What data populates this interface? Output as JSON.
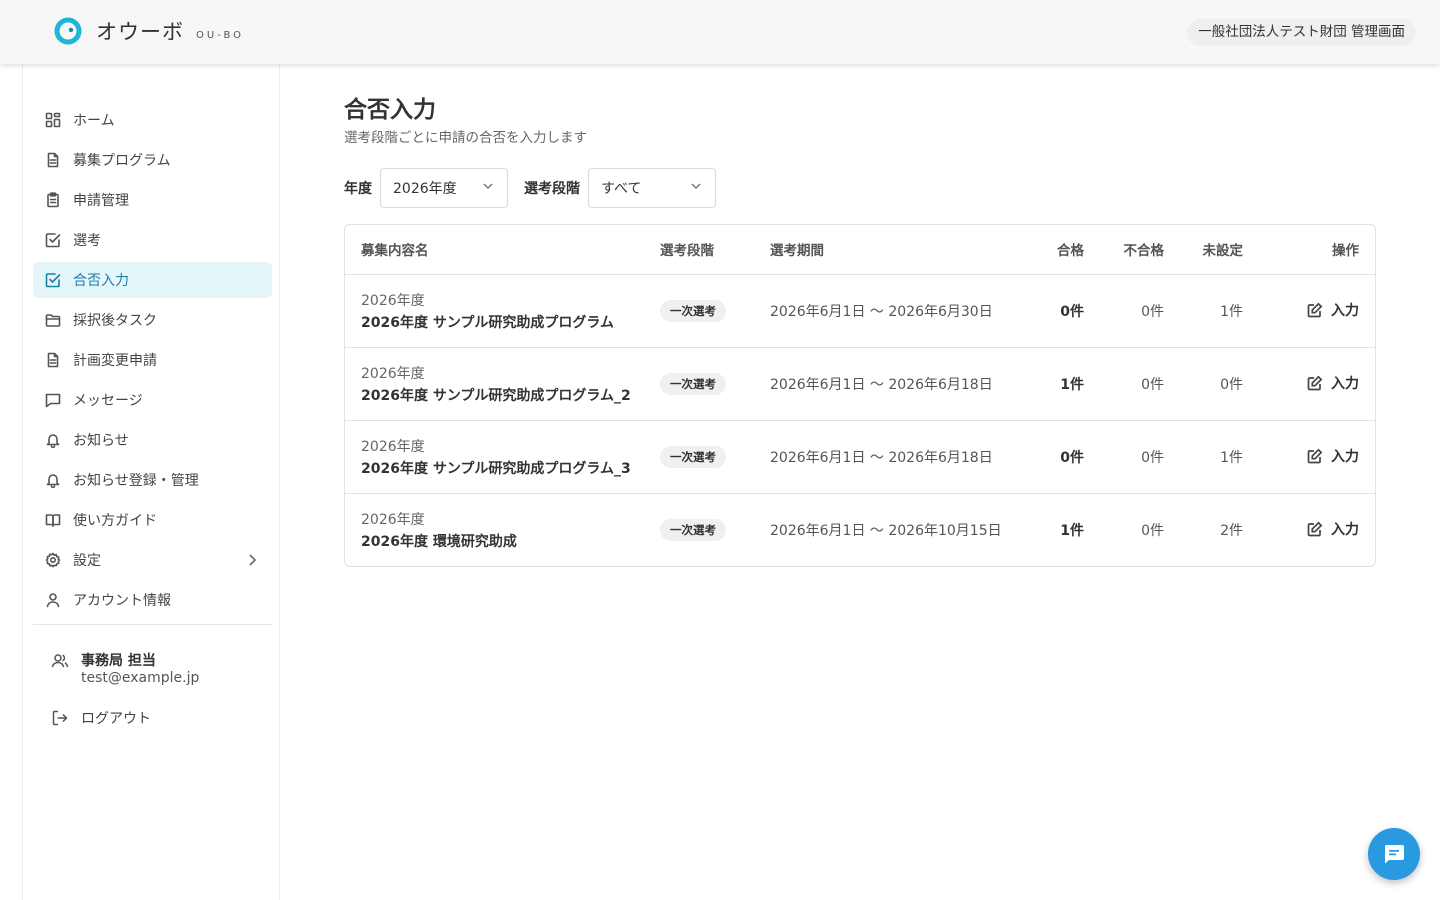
{
  "header": {
    "app_name": "オウーボ",
    "app_sub": "OU-BO",
    "org_label": "一般社団法人テスト財団 管理画面",
    "brand_color": "#1cb6d6"
  },
  "sidebar": {
    "items": [
      {
        "label": "ホーム",
        "icon": "grid-icon"
      },
      {
        "label": "募集プログラム",
        "icon": "document-icon"
      },
      {
        "label": "申請管理",
        "icon": "clipboard-icon"
      },
      {
        "label": "選考",
        "icon": "checkbox-icon"
      },
      {
        "label": "合否入力",
        "icon": "checkbox-icon",
        "active": true
      },
      {
        "label": "採択後タスク",
        "icon": "folder-icon"
      },
      {
        "label": "計画変更申請",
        "icon": "document-icon"
      },
      {
        "label": "メッセージ",
        "icon": "message-icon"
      },
      {
        "label": "お知らせ",
        "icon": "bell-icon"
      },
      {
        "label": "お知らせ登録・管理",
        "icon": "bell-icon"
      },
      {
        "label": "使い方ガイド",
        "icon": "book-icon"
      },
      {
        "label": "設定",
        "icon": "gear-icon"
      },
      {
        "label": "アカウント情報",
        "icon": "user-icon"
      }
    ],
    "user": {
      "name": "事務局 担当",
      "email": "test@example.jp"
    },
    "logout_label": "ログアウト"
  },
  "main": {
    "title": "合否入力",
    "subtitle": "選考段階ごとに申請の合否を入力します",
    "filters": {
      "year_label": "年度",
      "year_value": "2026年度",
      "stage_label": "選考段階",
      "stage_value": "すべて"
    },
    "table": {
      "headers": {
        "name": "募集内容名",
        "stage": "選考段階",
        "period": "選考期間",
        "pass": "合格",
        "fail": "不合格",
        "unset": "未設定",
        "op": "操作"
      },
      "rows": [
        {
          "year": "2026年度",
          "name": "2026年度 サンプル研究助成プログラム",
          "stage": "一次選考",
          "period": "2026年6月1日 〜 2026年6月30日",
          "pass": "0件",
          "fail": "0件",
          "unset": "1件",
          "op": "入力"
        },
        {
          "year": "2026年度",
          "name": "2026年度 サンプル研究助成プログラム_2",
          "stage": "一次選考",
          "period": "2026年6月1日 〜 2026年6月18日",
          "pass": "1件",
          "fail": "0件",
          "unset": "0件",
          "op": "入力"
        },
        {
          "year": "2026年度",
          "name": "2026年度 サンプル研究助成プログラム_3",
          "stage": "一次選考",
          "period": "2026年6月1日 〜 2026年6月18日",
          "pass": "0件",
          "fail": "0件",
          "unset": "1件",
          "op": "入力"
        },
        {
          "year": "2026年度",
          "name": "2026年度 環境研究助成",
          "stage": "一次選考",
          "period": "2026年6月1日 〜 2026年10月15日",
          "pass": "1件",
          "fail": "0件",
          "unset": "2件",
          "op": "入力"
        }
      ]
    }
  },
  "fab": {
    "icon": "chat-icon",
    "color": "#2a9ae0"
  }
}
